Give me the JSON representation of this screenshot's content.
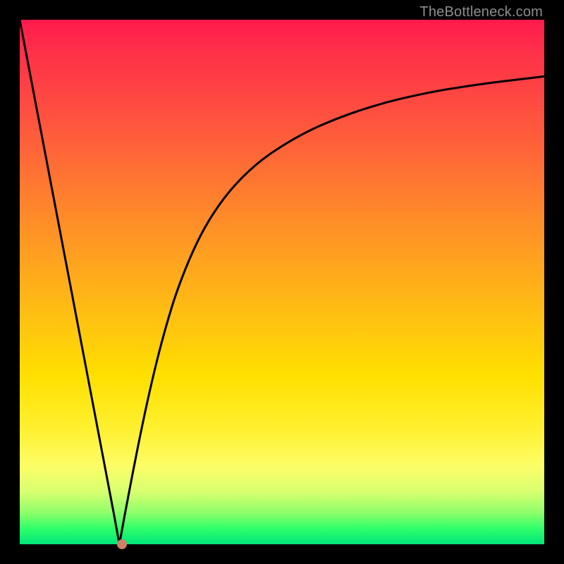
{
  "watermark": "TheBottleneck.com",
  "colors": {
    "frame": "#000000",
    "curve": "#000000",
    "marker": "#d08068",
    "gradient_top": "#ff1a4d",
    "gradient_bottom": "#00e57a"
  },
  "chart_data": {
    "type": "line",
    "title": "",
    "xlabel": "",
    "ylabel": "",
    "xlim": [
      0,
      1
    ],
    "ylim": [
      0,
      1
    ],
    "x": [
      0.0,
      0.02,
      0.04,
      0.06,
      0.08,
      0.1,
      0.12,
      0.14,
      0.16,
      0.18,
      0.19,
      0.2,
      0.22,
      0.24,
      0.26,
      0.28,
      0.3,
      0.33,
      0.36,
      0.4,
      0.45,
      0.5,
      0.55,
      0.6,
      0.65,
      0.7,
      0.75,
      0.8,
      0.85,
      0.9,
      0.95,
      1.0
    ],
    "y": [
      1.0,
      0.895,
      0.79,
      0.685,
      0.58,
      0.475,
      0.37,
      0.265,
      0.16,
      0.055,
      0.0,
      0.055,
      0.16,
      0.258,
      0.345,
      0.42,
      0.485,
      0.56,
      0.618,
      0.675,
      0.725,
      0.76,
      0.788,
      0.81,
      0.828,
      0.843,
      0.855,
      0.865,
      0.873,
      0.88,
      0.886,
      0.892
    ],
    "marker": {
      "x": 0.195,
      "y": 0.0
    },
    "annotations": []
  }
}
